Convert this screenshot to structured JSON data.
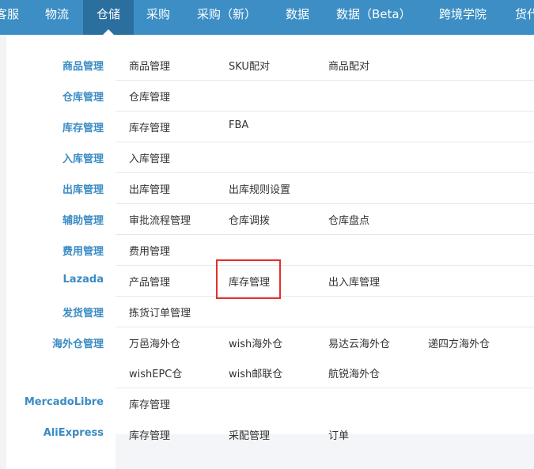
{
  "topnav": {
    "items": [
      {
        "label": "客服",
        "active": false
      },
      {
        "label": "物流",
        "active": false
      },
      {
        "label": "仓储",
        "active": true
      },
      {
        "label": "采购",
        "active": false
      },
      {
        "label": "采购（新）",
        "active": false
      },
      {
        "label": "数据",
        "active": false
      },
      {
        "label": "数据（Beta）",
        "active": false
      },
      {
        "label": "跨境学院",
        "active": false
      },
      {
        "label": "货代",
        "active": false
      }
    ],
    "bg_color": "#3c8ec4",
    "active_color": "#2b6f9f"
  },
  "menu": {
    "category_color": "#3a8bc4",
    "highlight_color": "#e0312b",
    "rows": [
      {
        "category": "商品管理",
        "links": [
          "商品管理",
          "SKU配对",
          "商品配对"
        ]
      },
      {
        "category": "仓库管理",
        "links": [
          "仓库管理"
        ]
      },
      {
        "category": "库存管理",
        "links": [
          "库存管理",
          "FBA"
        ]
      },
      {
        "category": "入库管理",
        "links": [
          "入库管理"
        ]
      },
      {
        "category": "出库管理",
        "links": [
          "出库管理",
          "出库规则设置"
        ]
      },
      {
        "category": "辅助管理",
        "links": [
          "审批流程管理",
          "仓库调拨",
          "仓库盘点"
        ]
      },
      {
        "category": "费用管理",
        "links": [
          "费用管理"
        ]
      },
      {
        "category": "Lazada",
        "links": [
          "产品管理",
          "库存管理",
          "出入库管理"
        ]
      },
      {
        "category": "发货管理",
        "links": [
          "拣货订单管理"
        ]
      },
      {
        "category": "海外仓管理",
        "links": [
          "万邑海外仓",
          "wish海外仓",
          "易达云海外仓",
          "递四方海外仓",
          "wishEPC仓",
          "wish邮联仓",
          "航锐海外仓"
        ]
      },
      {
        "category": "MercadoLibre",
        "links": [
          "库存管理"
        ]
      },
      {
        "category": "AliExpress",
        "links": [
          "库存管理",
          "采配管理",
          "订单"
        ]
      }
    ]
  }
}
